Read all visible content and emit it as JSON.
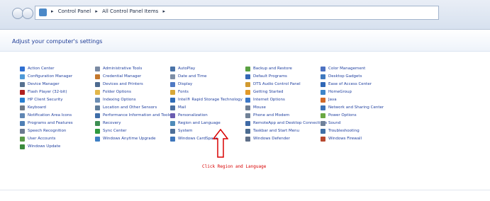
{
  "address_bar": {
    "crumbs": [
      "Control Panel",
      "All Control Panel Items"
    ]
  },
  "header": {
    "title": "Adjust your computer's settings"
  },
  "items": [
    {
      "label": "Action Center",
      "icon": "flag-icon",
      "color": "#2f6fd1"
    },
    {
      "label": "Configuration Manager",
      "icon": "config-icon",
      "color": "#4f9ad8"
    },
    {
      "label": "Device Manager",
      "icon": "device-icon",
      "color": "#56708f"
    },
    {
      "label": "Flash Player (32-bit)",
      "icon": "flash-icon",
      "color": "#b02020"
    },
    {
      "label": "HP Client Security",
      "icon": "security-icon",
      "color": "#2a7fd0"
    },
    {
      "label": "Keyboard",
      "icon": "keyboard-icon",
      "color": "#707a86"
    },
    {
      "label": "Notification Area Icons",
      "icon": "notification-icon",
      "color": "#5f86b3"
    },
    {
      "label": "Programs and Features",
      "icon": "programs-icon",
      "color": "#4f7fb5"
    },
    {
      "label": "Speech Recognition",
      "icon": "microphone-icon",
      "color": "#6c7a8f"
    },
    {
      "label": "User Accounts",
      "icon": "user-icon",
      "color": "#5a9b47"
    },
    {
      "label": "Windows Update",
      "icon": "update-icon",
      "color": "#3b8a3b"
    },
    {
      "label": "",
      "icon": "",
      "color": ""
    },
    {
      "label": "Administrative Tools",
      "icon": "admin-tools-icon",
      "color": "#7a8aa3"
    },
    {
      "label": "Credential Manager",
      "icon": "credential-icon",
      "color": "#c4772c"
    },
    {
      "label": "Devices and Printers",
      "icon": "printer-icon",
      "color": "#4d6a8f"
    },
    {
      "label": "Folder Options",
      "icon": "folder-icon",
      "color": "#e2b74a"
    },
    {
      "label": "Indexing Options",
      "icon": "indexing-icon",
      "color": "#6c8db3"
    },
    {
      "label": "Location and Other Sensors",
      "icon": "location-icon",
      "color": "#5f7c99"
    },
    {
      "label": "Performance Information and Tools",
      "icon": "performance-icon",
      "color": "#3e6da8"
    },
    {
      "label": "Recovery",
      "icon": "recovery-icon",
      "color": "#3d8f52"
    },
    {
      "label": "Sync Center",
      "icon": "sync-icon",
      "color": "#2f9a3f"
    },
    {
      "label": "Windows Anytime Upgrade",
      "icon": "upgrade-icon",
      "color": "#3e7fc4"
    },
    {
      "label": "",
      "icon": "",
      "color": ""
    },
    {
      "label": "",
      "icon": "",
      "color": ""
    },
    {
      "label": "AutoPlay",
      "icon": "autoplay-icon",
      "color": "#4a73a8"
    },
    {
      "label": "Date and Time",
      "icon": "clock-icon",
      "color": "#7d8ea6"
    },
    {
      "label": "Display",
      "icon": "display-icon",
      "color": "#4f79c3"
    },
    {
      "label": "Fonts",
      "icon": "fonts-icon",
      "color": "#d8a838"
    },
    {
      "label": "Intel® Rapid Storage Technology",
      "icon": "storage-icon",
      "color": "#2f6cb7"
    },
    {
      "label": "Mail",
      "icon": "mail-icon",
      "color": "#4a6fa1"
    },
    {
      "label": "Personalization",
      "icon": "personalization-icon",
      "color": "#6a5cb0"
    },
    {
      "label": "Region and Language",
      "icon": "globe-icon",
      "color": "#4f8bb9"
    },
    {
      "label": "System",
      "icon": "system-icon",
      "color": "#4e6f98"
    },
    {
      "label": "Windows CardSpace",
      "icon": "cardspace-icon",
      "color": "#3f76bb"
    },
    {
      "label": "",
      "icon": "",
      "color": ""
    },
    {
      "label": "",
      "icon": "",
      "color": ""
    },
    {
      "label": "Backup and Restore",
      "icon": "backup-icon",
      "color": "#5aa142"
    },
    {
      "label": "Default Programs",
      "icon": "default-programs-icon",
      "color": "#3568b6"
    },
    {
      "label": "DTS Audio Control Panel",
      "icon": "audio-icon",
      "color": "#d19a30"
    },
    {
      "label": "Getting Started",
      "icon": "getting-started-icon",
      "color": "#e29a2a"
    },
    {
      "label": "Internet Options",
      "icon": "internet-icon",
      "color": "#3c78c7"
    },
    {
      "label": "Mouse",
      "icon": "mouse-icon",
      "color": "#6e7e93"
    },
    {
      "label": "Phone and Modem",
      "icon": "phone-icon",
      "color": "#708197"
    },
    {
      "label": "RemoteApp and Desktop Connections",
      "icon": "remote-icon",
      "color": "#3f6aa6"
    },
    {
      "label": "Taskbar and Start Menu",
      "icon": "taskbar-icon",
      "color": "#4c6c90"
    },
    {
      "label": "Windows Defender",
      "icon": "defender-icon",
      "color": "#5f6f88"
    },
    {
      "label": "",
      "icon": "",
      "color": ""
    },
    {
      "label": "",
      "icon": "",
      "color": ""
    },
    {
      "label": "Color Management",
      "icon": "color-icon",
      "color": "#4d72c2"
    },
    {
      "label": "Desktop Gadgets",
      "icon": "gadgets-icon",
      "color": "#3f79bf"
    },
    {
      "label": "Ease of Access Center",
      "icon": "ease-icon",
      "color": "#2f67b6"
    },
    {
      "label": "HomeGroup",
      "icon": "homegroup-icon",
      "color": "#3d86c9"
    },
    {
      "label": "Java",
      "icon": "java-icon",
      "color": "#d26a29"
    },
    {
      "label": "Network and Sharing Center",
      "icon": "network-icon",
      "color": "#3c73b8"
    },
    {
      "label": "Power Options",
      "icon": "power-icon",
      "color": "#6aa843"
    },
    {
      "label": "Sound",
      "icon": "sound-icon",
      "color": "#6f819a"
    },
    {
      "label": "Troubleshooting",
      "icon": "troubleshoot-icon",
      "color": "#3f6fa7"
    },
    {
      "label": "Windows Firewall",
      "icon": "firewall-icon",
      "color": "#b7482f"
    },
    {
      "label": "",
      "icon": "",
      "color": ""
    },
    {
      "label": "",
      "icon": "",
      "color": ""
    }
  ],
  "annotation": {
    "text": "Click Region and Language",
    "color": "#d80000"
  }
}
